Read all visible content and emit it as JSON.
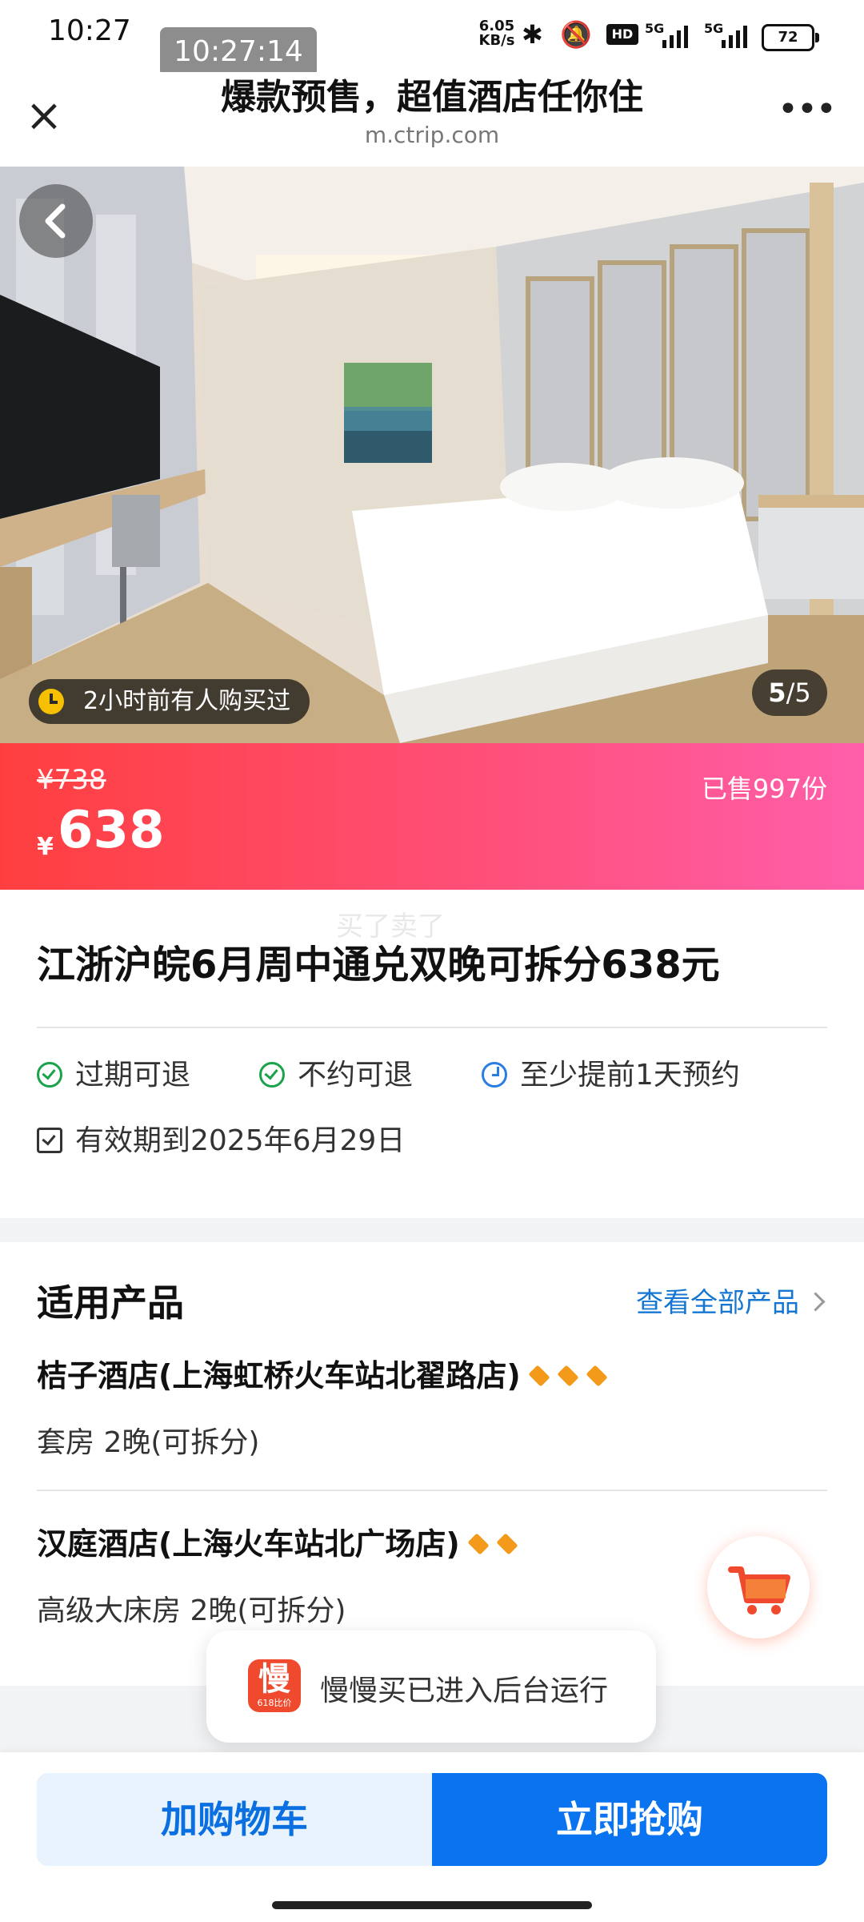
{
  "status_bar": {
    "time": "10:27",
    "screen_time_chip": "10:27:14",
    "net_speed": "6.05",
    "net_unit": "KB/s",
    "hd_label": "HD",
    "signal_label_1": "5G",
    "signal_label_2": "5G",
    "battery": "72"
  },
  "header": {
    "title": "爆款预售，超值酒店任你住",
    "url": "m.ctrip.com"
  },
  "gallery": {
    "recent_purchase": "2小时前有人购买过",
    "counter_current": "5",
    "counter_total": "/5"
  },
  "price": {
    "original": "¥738",
    "currency": "¥",
    "current": "638",
    "sold": "已售997份"
  },
  "product": {
    "watermark": "买了卖了",
    "title": "江浙沪皖6月周中通兑双晚可拆分638元",
    "tags": [
      "过期可退",
      "不约可退",
      "至少提前1天预约"
    ],
    "validity": "有效期到2025年6月29日"
  },
  "applicable": {
    "section_title": "适用产品",
    "view_all": "查看全部产品",
    "hotels": [
      {
        "name": "桔子酒店(上海虹桥火车站北翟路店)",
        "diamonds": 3,
        "room": "套房 2晚(可拆分)"
      },
      {
        "name": "汉庭酒店(上海火车站北广场店)",
        "diamonds": 2,
        "room": "高级大床房 2晚(可拆分)"
      }
    ]
  },
  "toast": {
    "logo_text": "慢",
    "logo_subtext": "618比价",
    "message": "慢慢买已进入后台运行"
  },
  "actions": {
    "add_to_cart": "加购物车",
    "buy_now": "立即抢购"
  },
  "colors": {
    "accent_blue": "#0a73f0",
    "price_gradient_start": "#ff3f3f",
    "price_gradient_end": "#ff5eaa",
    "check_green": "#1aa34a",
    "diamond_orange": "#f39a1b"
  }
}
